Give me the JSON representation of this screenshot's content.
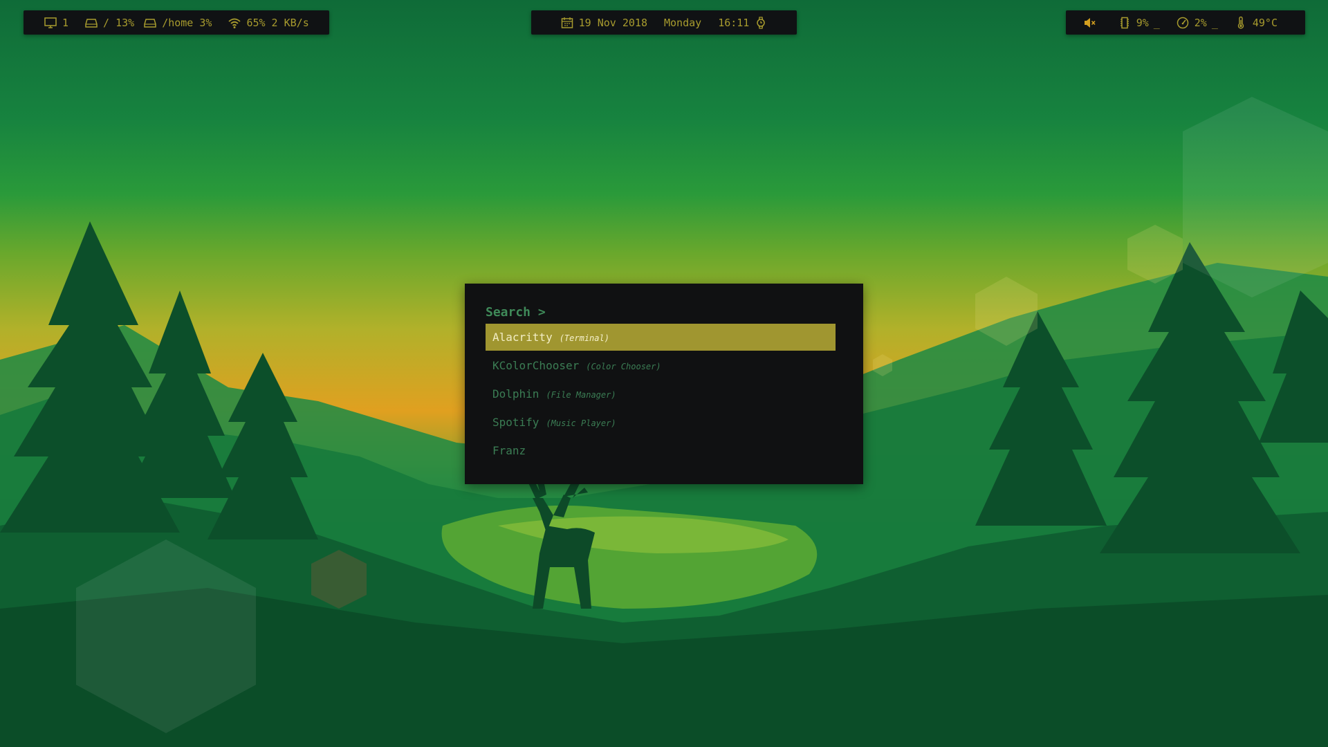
{
  "colors": {
    "bar_bg": "#101214",
    "bar_text": "#a89c2e",
    "launcher_bg": "#101112",
    "selection": "#a09630",
    "accent_green": "#3f8a59"
  },
  "bar_left": {
    "workspace": {
      "icon": "monitor-icon",
      "value": "1"
    },
    "root_disk": {
      "icon": "hard-drive-icon",
      "value": "/ 13%"
    },
    "home_disk": {
      "icon": "hard-drive-icon",
      "value": "/home 3%"
    },
    "wifi": {
      "icon": "wifi-icon",
      "value": "65% 2 KB/s"
    }
  },
  "bar_center": {
    "date": {
      "icon": "calendar-icon",
      "value": "19 Nov 2018"
    },
    "weekday": "Monday",
    "time": {
      "icon": "watch-icon",
      "value": "16:11"
    }
  },
  "bar_right": {
    "volume": {
      "icon": "volume-muted-icon"
    },
    "memory": {
      "icon": "memory-icon",
      "value": "9%"
    },
    "memory_indicator": "_",
    "cpu": {
      "icon": "gauge-icon",
      "value": "2%"
    },
    "cpu_indicator": "_",
    "temperature": {
      "icon": "thermometer-icon",
      "value": "49°C"
    }
  },
  "launcher": {
    "prompt": "Search >",
    "query": "",
    "results": [
      {
        "name": "Alacritty",
        "description": "(Terminal)",
        "selected": true
      },
      {
        "name": "KColorChooser",
        "description": "(Color Chooser)",
        "selected": false
      },
      {
        "name": "Dolphin",
        "description": "(File Manager)",
        "selected": false
      },
      {
        "name": "Spotify",
        "description": "(Music Player)",
        "selected": false
      },
      {
        "name": "Franz",
        "description": "",
        "selected": false
      }
    ]
  }
}
